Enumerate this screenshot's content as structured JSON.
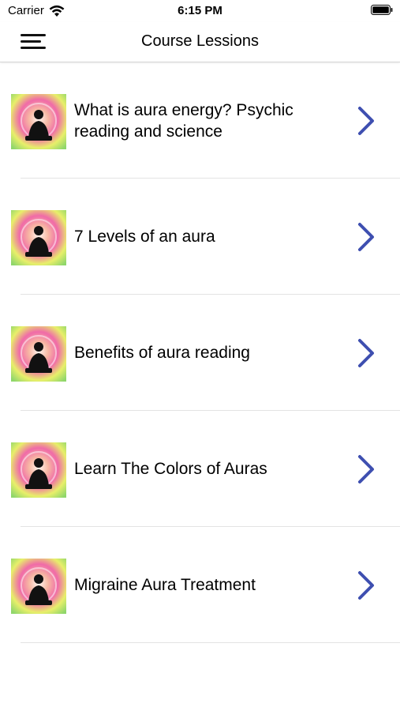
{
  "status_bar": {
    "carrier": "Carrier",
    "time": "6:15 PM",
    "icons": [
      "wifi-icon",
      "battery-icon"
    ]
  },
  "nav": {
    "title": "Course Lessions",
    "menu_icon": "hamburger-menu-icon"
  },
  "lessons": [
    {
      "title": "What is aura energy? Psychic reading and science",
      "thumbnail": "meditation-aura-thumbnail",
      "chevron": "chevron-right-icon"
    },
    {
      "title": "7 Levels of an aura",
      "thumbnail": "meditation-aura-thumbnail",
      "chevron": "chevron-right-icon"
    },
    {
      "title": "Benefits of aura reading",
      "thumbnail": "meditation-aura-thumbnail",
      "chevron": "chevron-right-icon"
    },
    {
      "title": "Learn The Colors of Auras",
      "thumbnail": "meditation-aura-thumbnail",
      "chevron": "chevron-right-icon"
    },
    {
      "title": "Migraine Aura Treatment",
      "thumbnail": "meditation-aura-thumbnail",
      "chevron": "chevron-right-icon"
    }
  ],
  "colors": {
    "chevron": "#3e4fb0",
    "separator": "#e3e3e3",
    "aura_pink": "#f06aa8",
    "aura_yellow": "#e8ef6a",
    "aura_green": "#8fd66b"
  }
}
